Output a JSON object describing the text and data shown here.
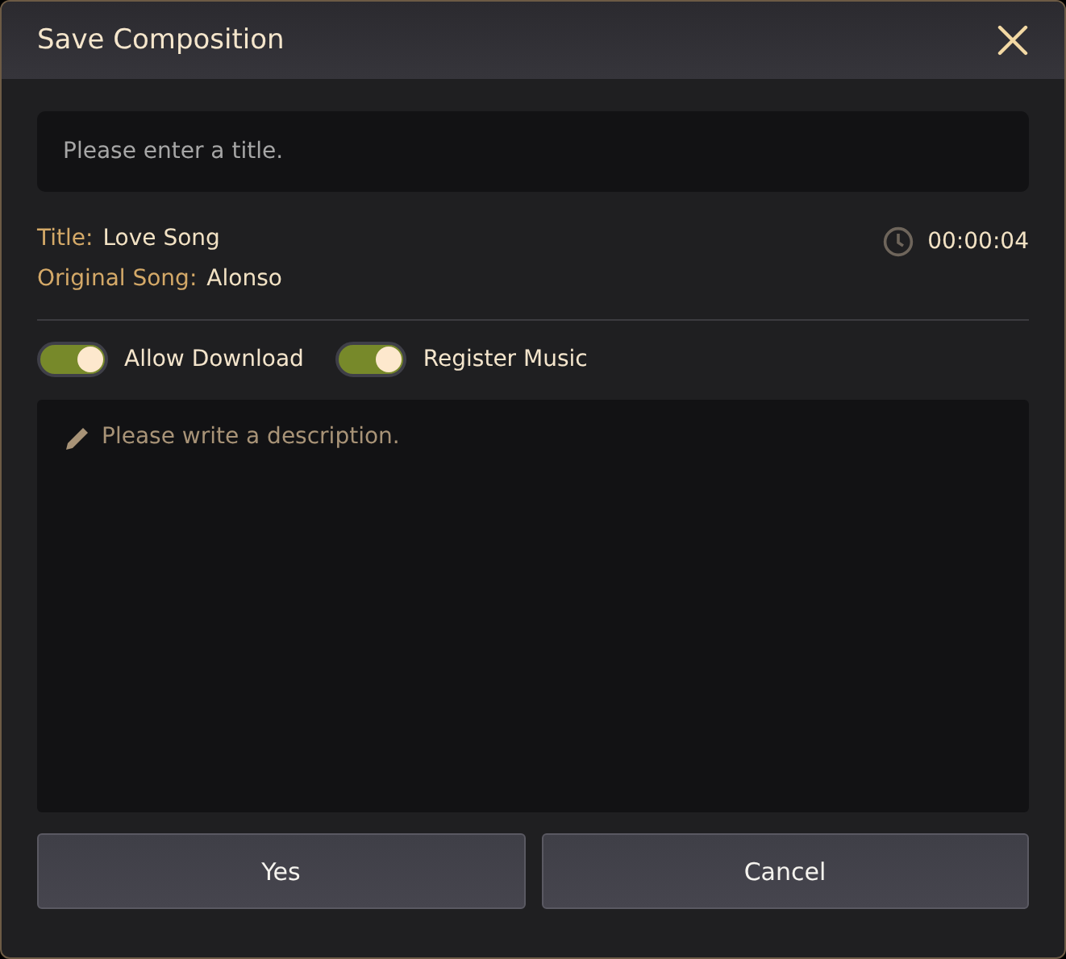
{
  "window": {
    "title": "Save Composition"
  },
  "title_field": {
    "placeholder": "Please enter a title."
  },
  "info": [
    {
      "label": "Title:",
      "value": "Love Song"
    },
    {
      "label": "Original Song:",
      "value": "Alonso"
    }
  ],
  "duration": "00:00:04",
  "toggles": [
    {
      "label": "Allow Download",
      "on": true
    },
    {
      "label": "Register Music",
      "on": true
    }
  ],
  "description": {
    "placeholder": "Please write a description."
  },
  "buttons": [
    "Yes",
    "Cancel"
  ]
}
